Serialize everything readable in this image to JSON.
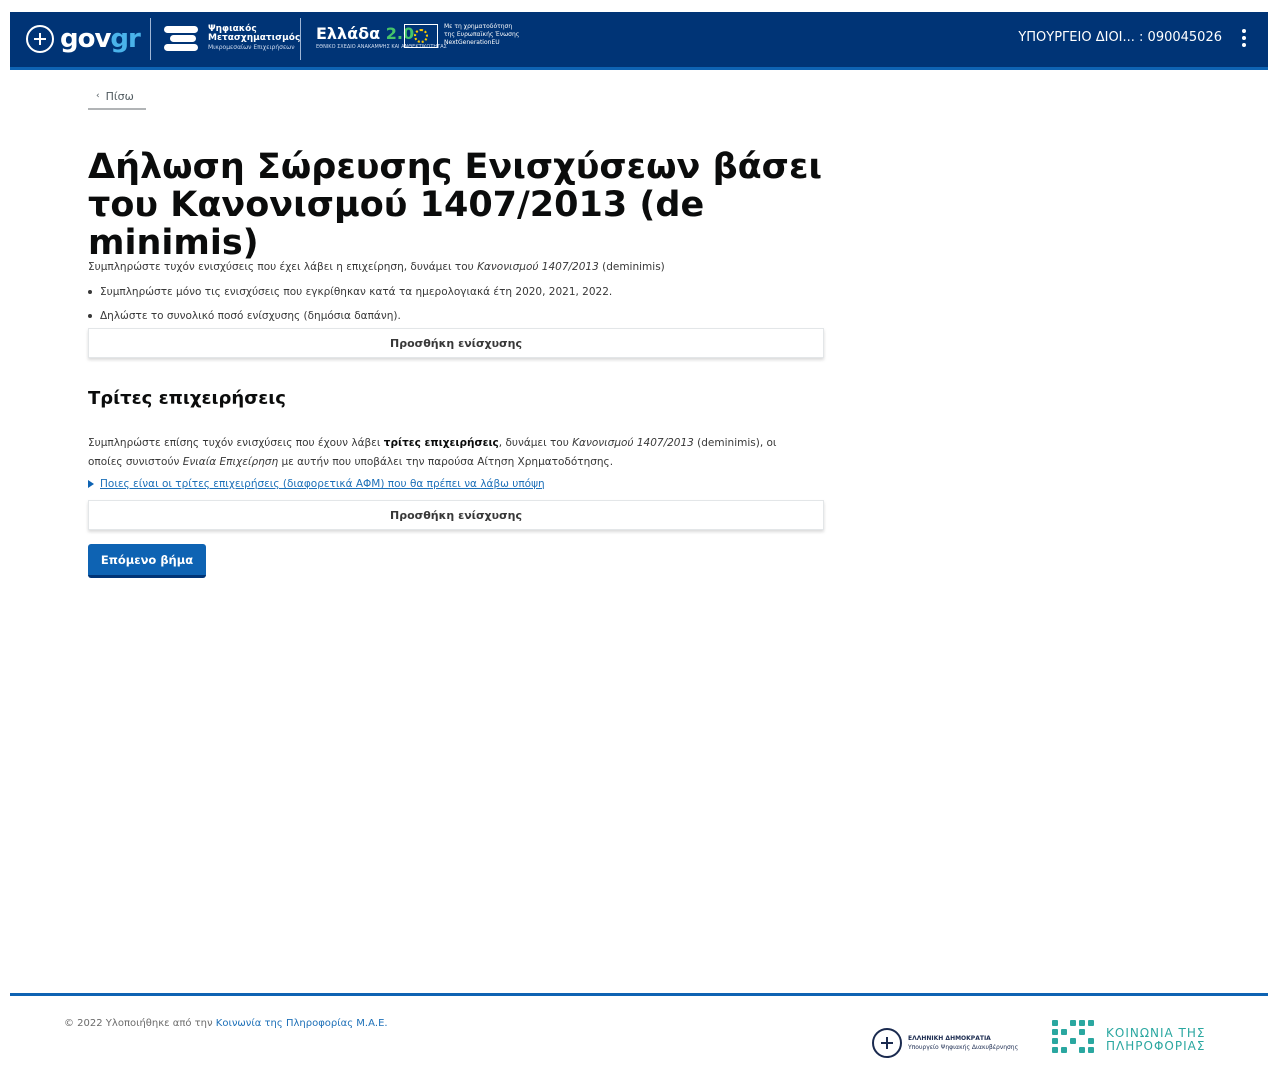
{
  "header": {
    "gov_logo": {
      "text_main": "gov",
      "text_accent": "gr"
    },
    "digital_logo": {
      "line1": "Ψηφιακός",
      "line2": "Μετασχηματισμός",
      "line3": "Μικρομεσαίων Επιχειρήσεων"
    },
    "ellada_logo": {
      "text": "Ελλάδα",
      "version": "2.0",
      "sub": "ΕΘΝΙΚΟ ΣΧΕΔΙΟ ΑΝΑΚΑΜΨΗΣ ΚΑΙ ΑΝΘΕΚΤΙΚΟΤΗΤΑΣ"
    },
    "eu_text": {
      "line1": "Με τη χρηματοδότηση",
      "line2": "της Ευρωπαϊκής Ένωσης",
      "line3": "NextGenerationEU"
    },
    "user_label": "ΥΠΟΥΡΓΕΙΟ ΔΙΟΙ... : 090045026"
  },
  "back_link": {
    "label": "Πίσω"
  },
  "page": {
    "title": "Δήλωση Σώρευσης Ενισχύσεων βάσει του Κανονισμού 1407/2013 (de minimis)",
    "intro": {
      "before": "Συμπληρώστε τυχόν ενισχύσεις που έχει λάβει η επιχείρηση, δυνάμει του ",
      "italic": "Κανονισμού 1407/2013",
      "after": " (deminimis)"
    },
    "bullets": [
      "Συμπληρώστε μόνο τις ενισχύσεις που εγκρίθηκαν κατά τα ημερολογιακά έτη 2020, 2021, 2022.",
      "Δηλώστε το συνολικό ποσό ενίσχυσης (δημόσια δαπάνη)."
    ],
    "add_aid_label_1": "Προσθήκη ενίσχυσης",
    "third_section": {
      "heading": "Τρίτες επιχειρήσεις",
      "p1_before": "Συμπληρώστε επίσης τυχόν ενισχύσεις που έχουν λάβει ",
      "p1_bold": "τρίτες επιχειρήσεις",
      "p1_mid": ", δυνάμει του ",
      "p1_italic": "Κανονισμού 1407/2013",
      "p1_after": " (deminimis), οι",
      "p2_before": "οποίες συνιστούν ",
      "p2_italic": "Ενιαία Επιχείρηση",
      "p2_after": " με αυτήν που υποβάλει την παρούσα Αίτηση Χρηματοδότησης.",
      "details_label": "Ποιες είναι οι τρίτες επιχειρήσεις (διαφορετικά ΑΦΜ) που θα πρέπει να λάβω υπόψη",
      "add_aid_label_2": "Προσθήκη ενίσχυσης"
    },
    "next_button_label": "Επόμενο βήμα"
  },
  "footer": {
    "copyright_prefix": "© 2022 Υλοποιήθηκε από την ",
    "copyright_link": "Κοινωνία της Πληροφορίας Μ.Α.Ε.",
    "gr_line1": "ΕΛΛΗΝΙΚΗ ΔΗΜΟΚΡΑΤΙΑ",
    "gr_line2": "Υπουργείο Ψηφιακής Διακυβέρνησης",
    "ktp_line1": "ΚΟΙΝΩΝΙΑ ΤΗΣ",
    "ktp_line2": "ΠΛΗΡΟΦΟΡΙΑΣ"
  },
  "colors": {
    "header_bg": "#003476",
    "primary": "#0e63b3",
    "link": "#1d70b8",
    "ktp_teal": "#2aa7a0"
  }
}
